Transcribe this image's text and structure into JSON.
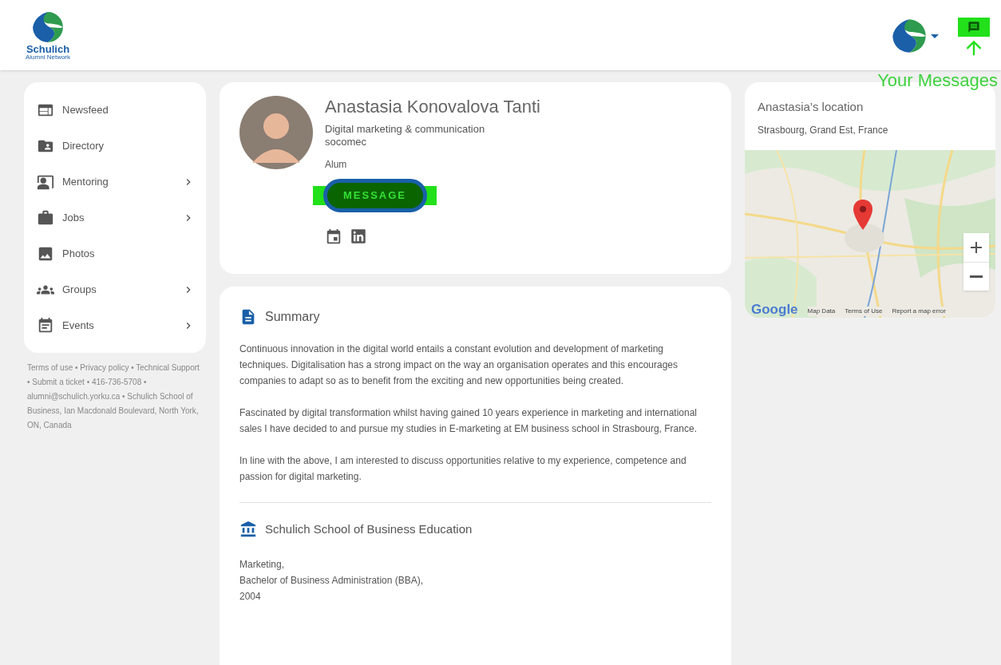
{
  "header": {
    "logo_text": "Schulich",
    "logo_subtitle": "Alumni Network",
    "annotation": "Your Messages"
  },
  "sidebar": {
    "items": [
      {
        "label": "Newsfeed",
        "kind": "newsfeed",
        "expandable": false
      },
      {
        "label": "Directory",
        "kind": "directory",
        "expandable": false
      },
      {
        "label": "Mentoring",
        "kind": "mentoring",
        "expandable": true
      },
      {
        "label": "Jobs",
        "kind": "jobs",
        "expandable": true
      },
      {
        "label": "Photos",
        "kind": "photos",
        "expandable": false
      },
      {
        "label": "Groups",
        "kind": "groups",
        "expandable": true
      },
      {
        "label": "Events",
        "kind": "events",
        "expandable": true
      }
    ],
    "footer": "Terms of use • Privacy policy • Technical Support • Submit a ticket • 416-736-5708 • alumni@schulich.yorku.ca • Schulich School of Business, Ian Macdonald Boulevard, North York, ON, Canada"
  },
  "profile": {
    "name": "Anastasia Konovalova Tanti",
    "title": "Digital marketing & communication",
    "company": "socomec",
    "member_type": "Alum",
    "button": "MESSAGE"
  },
  "summary": {
    "heading": "Summary",
    "paragraphs": [
      "Continuous innovation in the digital world entails a constant evolution and development of marketing techniques. Digitalisation has a strong impact on the way an organisation operates and this encourages companies to adapt so as to benefit from the exciting and new opportunities being created.",
      "Fascinated by digital transformation whilst having gained 10 years experience in marketing and international sales I have decided to and pursue my studies in E-marketing at EM business school in Strasbourg, France.",
      "In line with the above, I am interested to discuss opportunities relative to my experience, competence and passion for digital marketing."
    ]
  },
  "education": {
    "heading": "Schulich School of Business Education",
    "lines": [
      "Marketing,",
      "Bachelor of Business Administration (BBA),",
      "2004"
    ]
  },
  "location": {
    "title": "Anastasia’s location",
    "place": "Strasbourg, Grand Est, France",
    "map_links": [
      "Map Data",
      "Terms of Use",
      "Report a map error"
    ],
    "map_brand": "Google"
  }
}
